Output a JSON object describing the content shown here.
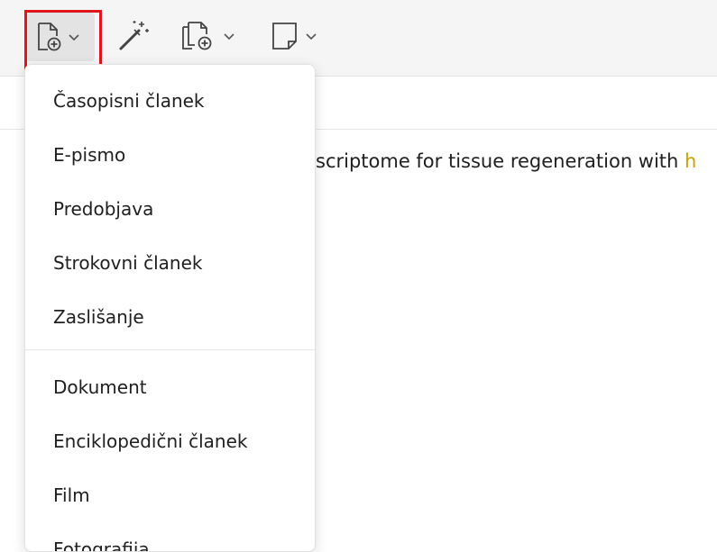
{
  "toolbar": {
    "buttons": [
      {
        "name": "new-item",
        "icon": "document-plus-icon",
        "has_dropdown": true,
        "active": true
      },
      {
        "name": "magic",
        "icon": "magic-wand-icon",
        "has_dropdown": false
      },
      {
        "name": "add-attachment",
        "icon": "stacked-documents-plus-icon",
        "has_dropdown": true
      },
      {
        "name": "add-note",
        "icon": "note-icon",
        "has_dropdown": true
      }
    ],
    "highlight_color": "#e0141b"
  },
  "background": {
    "item_title_visible": "scriptome for tissue regeneration with ",
    "item_title_tail": "h"
  },
  "menu": {
    "group1": [
      {
        "label": "Časopisni članek"
      },
      {
        "label": "E-pismo"
      },
      {
        "label": "Predobjava"
      },
      {
        "label": "Strokovni članek"
      },
      {
        "label": "Zaslišanje"
      }
    ],
    "group2": [
      {
        "label": "Dokument"
      },
      {
        "label": "Enciklopedični članek"
      },
      {
        "label": "Film"
      },
      {
        "label": "Fotografija"
      }
    ]
  }
}
